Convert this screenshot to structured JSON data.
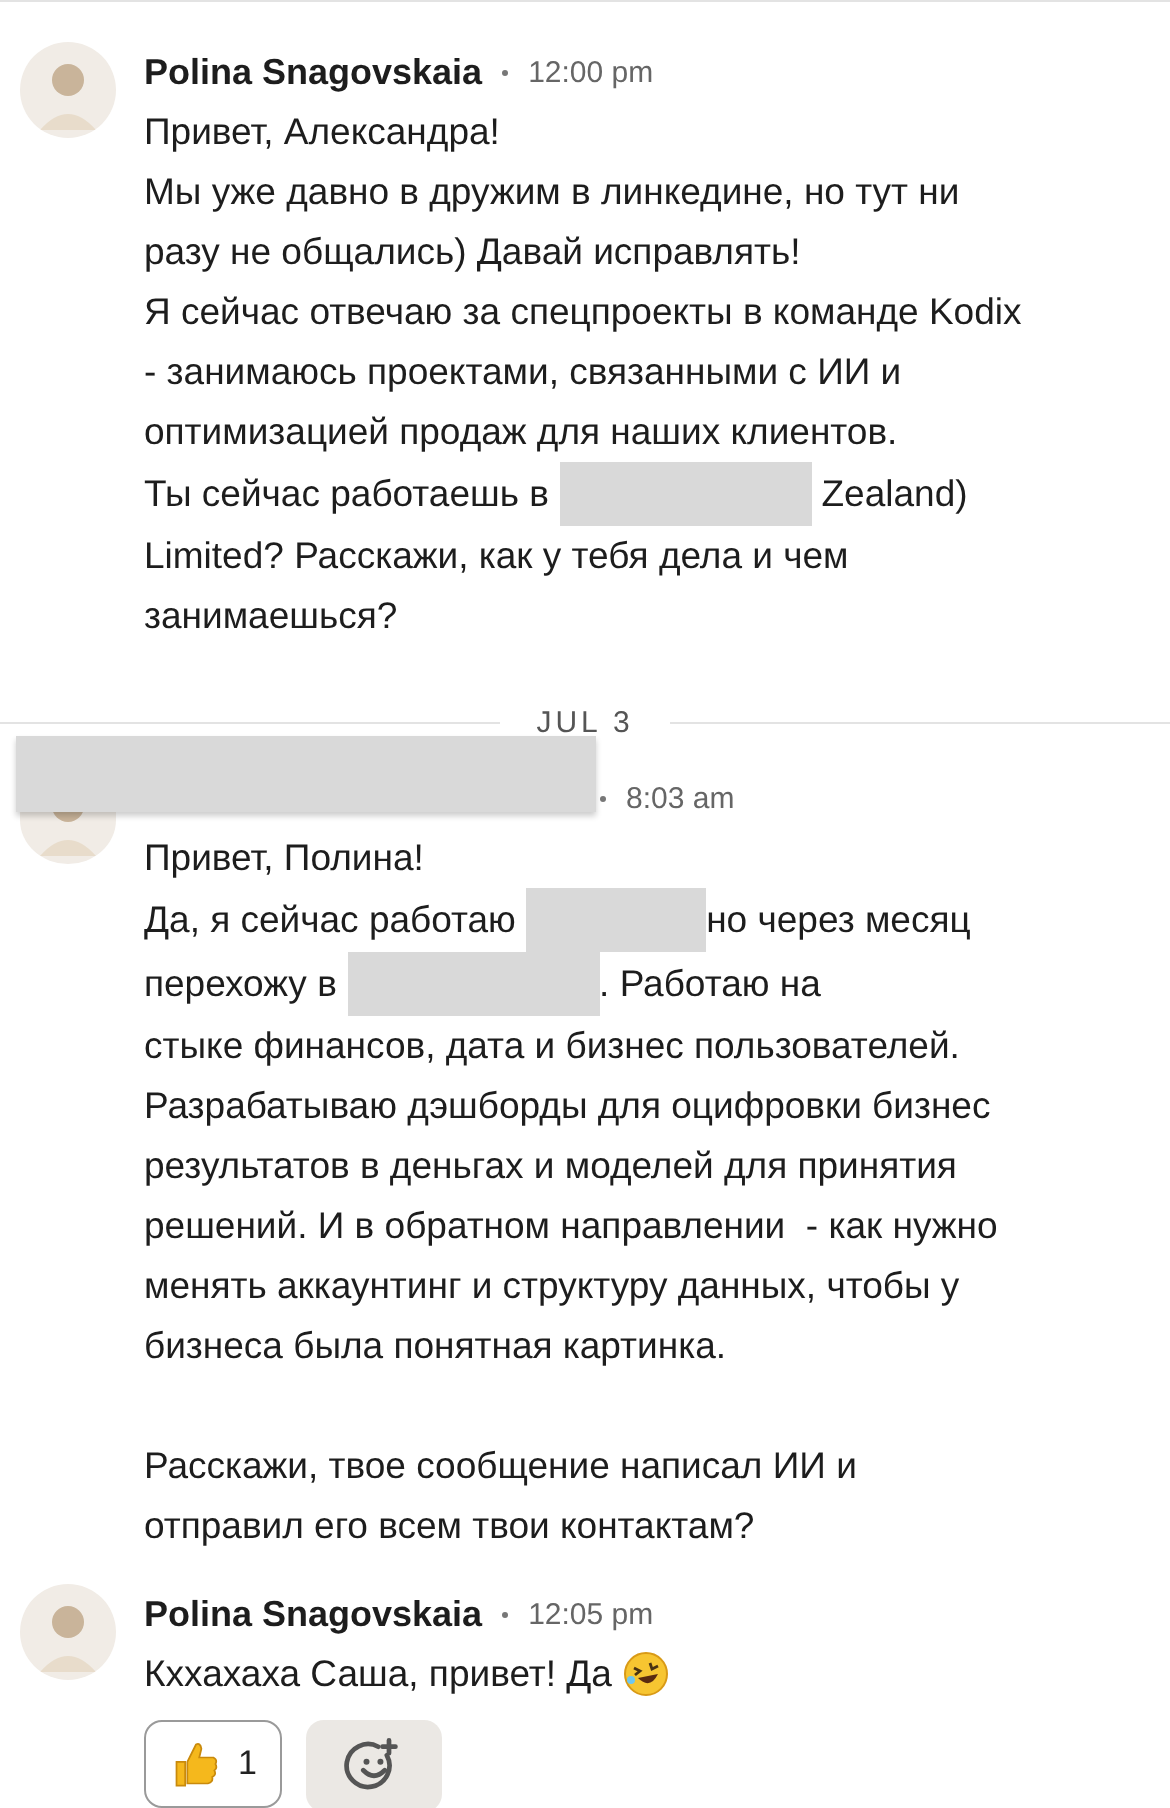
{
  "thread": [
    {
      "kind": "message",
      "sender": {
        "kind": "name",
        "text": "Polina Snagovskaia"
      },
      "time": "12:00 pm",
      "paragraphs": [
        [
          "Привет, Александра!",
          "Мы уже давно в дружим в линкедине, но тут ни",
          "разу не общались) Давай исправлять!",
          "Я сейчас отвечаю за спецпроекты в команде Kodix",
          "- занимаюсь проектами, связанными с ИИ и",
          "оптимизацией продаж для наших клиентов.",
          [
            {
              "text": "Ты сейчас работаешь в "
            },
            {
              "kind": "redacted"
            },
            {
              "text": " Zealand)"
            }
          ],
          "Limited? Расскажи, как у тебя дела и чем",
          "занимаешься?"
        ]
      ]
    },
    {
      "kind": "date",
      "label": "JUL 3"
    },
    {
      "kind": "message",
      "sender": {
        "kind": "redacted"
      },
      "time": "8:03 am",
      "paragraphs": [
        [
          "Привет, Полина!",
          [
            {
              "text": "Да, я сейчас работаю "
            },
            {
              "kind": "redacted_short"
            },
            {
              "text": "но через месяц"
            }
          ],
          [
            {
              "text": "перехожу в "
            },
            {
              "kind": "redacted"
            },
            {
              "text": ". Работаю на"
            }
          ],
          "стыке финансов, дата и бизнес пользователей.",
          "Разрабатываю дэшборды для оцифровки бизнес",
          "результатов в деньгах и моделей для принятия",
          "решений. И в обратном направлении  - как нужно",
          "менять аккаунтинг и структуру данных, чтобы у",
          "бизнеса была понятная картинка."
        ],
        [
          "Расскажи, твое сообщение написал ИИ и",
          "отправил его всем твои контактам?"
        ]
      ]
    },
    {
      "kind": "message",
      "sender": {
        "kind": "name",
        "text": "Polina Snagovskaia"
      },
      "time": "12:05 pm",
      "paragraphs": [
        [
          [
            {
              "text": "Кххахаха Саша, привет! Да "
            },
            {
              "kind": "emoji"
            }
          ]
        ]
      ],
      "reactions": [
        {
          "kind": "thumbs",
          "count": "1"
        },
        {
          "kind": "add"
        }
      ]
    }
  ]
}
